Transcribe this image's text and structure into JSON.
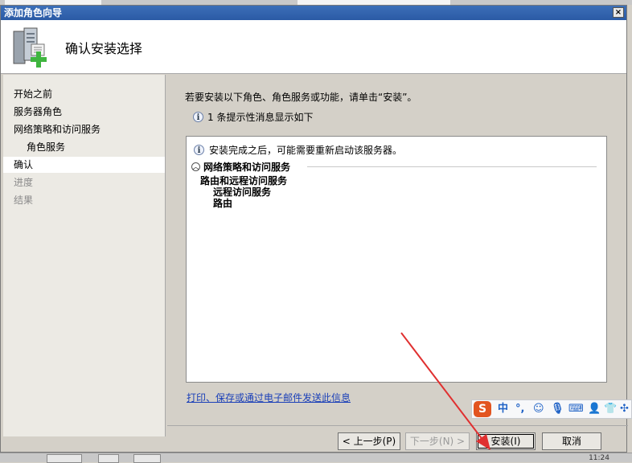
{
  "window": {
    "title": "添加角色向导",
    "close_glyph": "×"
  },
  "header": {
    "title": "确认安装选择"
  },
  "sidebar": {
    "items": [
      {
        "label": "开始之前"
      },
      {
        "label": "服务器角色"
      },
      {
        "label": "网络策略和访问服务"
      },
      {
        "label": "角色服务"
      },
      {
        "label": "确认"
      },
      {
        "label": "进度"
      },
      {
        "label": "结果"
      }
    ]
  },
  "main": {
    "intro": "若要安装以下角色、角色服务或功能，请单击“安装”。",
    "info_message": "1 条提示性消息显示如下",
    "note": "安装完成之后，可能需要重新启动该服务器。",
    "section_title": "网络策略和访问服务",
    "entries": [
      "路由和远程访问服务",
      "远程访问服务",
      "路由"
    ],
    "print_link": "打印、保存或通过电子邮件发送此信息"
  },
  "buttons": {
    "prev": "< 上一步(P)",
    "next": "下一步(N) >",
    "install": "安装(I)",
    "cancel": "取消"
  },
  "ime_toolbar": {
    "logo": "S",
    "mode": "中",
    "symbols": [
      "°,",
      "☺",
      "🎙",
      "⌨",
      "👤",
      "👕",
      "✣"
    ]
  },
  "taskbar": {
    "clock": "11:24"
  },
  "colors": {
    "titlebar": "#2b5aa5",
    "link": "#1a3fb8",
    "ime_logo": "#e25420",
    "ime_icons": "#1f62c6"
  }
}
